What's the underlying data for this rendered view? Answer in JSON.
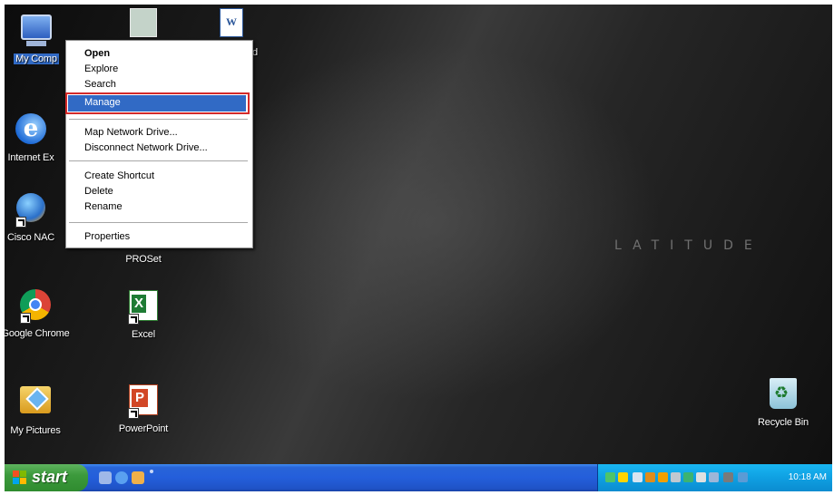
{
  "desktop": {
    "icons": [
      {
        "name": "my-computer",
        "label": "My Comp",
        "selected": true
      },
      {
        "name": "internet-explorer",
        "label": "Internet Ex"
      },
      {
        "name": "cisco-nac",
        "label": "Cisco NAC"
      },
      {
        "name": "google-chrome",
        "label": "Google Chrome"
      },
      {
        "name": "my-pictures",
        "label": "My Pictures"
      },
      {
        "name": "intel-proset",
        "label": "PROSet"
      },
      {
        "name": "excel",
        "label": "Excel"
      },
      {
        "name": "powerpoint",
        "label": "PowerPoint"
      },
      {
        "name": "word",
        "label": "d"
      },
      {
        "name": "recycle-bin",
        "label": "Recycle Bin"
      }
    ],
    "watermark": "LATITUDE"
  },
  "context_menu": {
    "items": [
      "Open",
      "Explore",
      "Search",
      "Manage",
      "Map Network Drive...",
      "Disconnect Network Drive...",
      "Create Shortcut",
      "Delete",
      "Rename",
      "Properties"
    ],
    "highlighted": "Manage"
  },
  "taskbar": {
    "start_label": "start",
    "clock": "10:18 AM"
  },
  "colors": {
    "selection": "#316ac5",
    "highlight_box": "#d42a2a",
    "taskbar": "#245edb",
    "start": "#3c9a3c",
    "tray": "#0fa0e2"
  }
}
